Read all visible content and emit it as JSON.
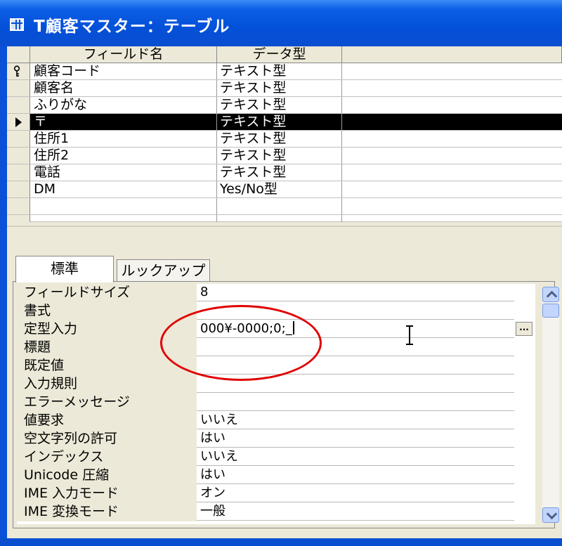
{
  "window": {
    "title": "T顧客マスター：テーブル",
    "title_icon": "table-icon",
    "titlebar_color": "#0a50d8"
  },
  "grid": {
    "columns": [
      "フィールド名",
      "データ型",
      ""
    ],
    "rows": [
      {
        "field": "顧客コード",
        "type": "テキスト型",
        "key": true
      },
      {
        "field": "顧客名",
        "type": "テキスト型"
      },
      {
        "field": "ふりがな",
        "type": "テキスト型"
      },
      {
        "field": "〒",
        "type": "テキスト型",
        "selected": true
      },
      {
        "field": "住所1",
        "type": "テキスト型"
      },
      {
        "field": "住所2",
        "type": "テキスト型"
      },
      {
        "field": "電話",
        "type": "テキスト型"
      },
      {
        "field": "DM",
        "type": "Yes/No型"
      },
      {
        "field": "",
        "type": ""
      },
      {
        "field": "",
        "type": ""
      }
    ]
  },
  "properties": {
    "tabs": [
      "標準",
      "ルックアップ"
    ],
    "active_tab": "標準",
    "rows": [
      {
        "label": "フィールドサイズ",
        "value": "8"
      },
      {
        "label": "書式",
        "value": ""
      },
      {
        "label": "定型入力",
        "value": "000¥-0000;0;_"
      },
      {
        "label": "標題",
        "value": ""
      },
      {
        "label": "既定値",
        "value": ""
      },
      {
        "label": "入力規則",
        "value": ""
      },
      {
        "label": "エラーメッセージ",
        "value": ""
      },
      {
        "label": "値要求",
        "value": "いいえ"
      },
      {
        "label": "空文字列の許可",
        "value": "はい"
      },
      {
        "label": "インデックス",
        "value": "いいえ"
      },
      {
        "label": "Unicode 圧縮",
        "value": "はい"
      },
      {
        "label": "IME 入力モード",
        "value": "オン"
      },
      {
        "label": "IME 変換モード",
        "value": "一般"
      }
    ],
    "builder_button": "...",
    "annotation_color": "#e00000"
  }
}
